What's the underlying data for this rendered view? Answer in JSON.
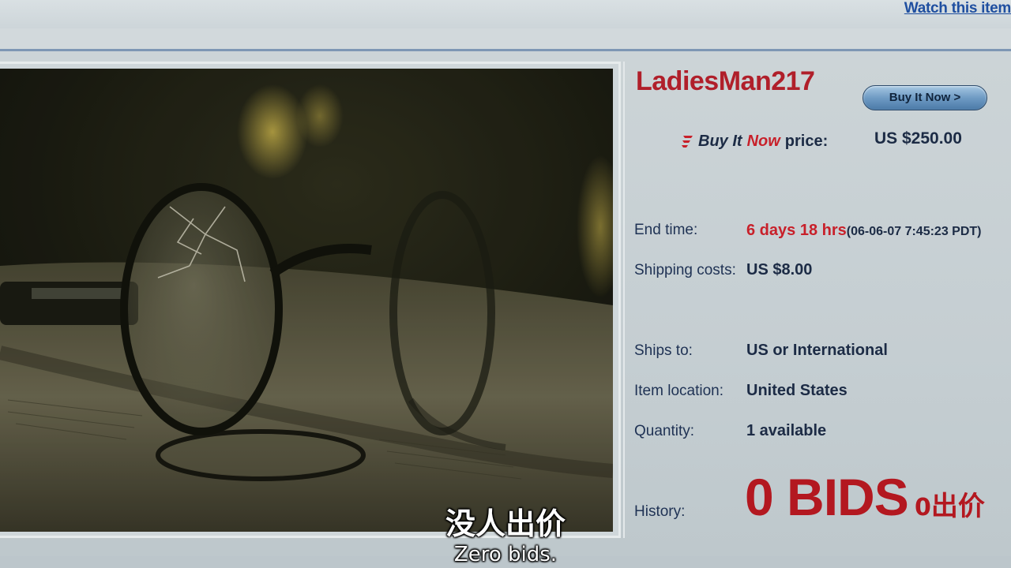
{
  "header": {
    "watch_link": "Watch this item"
  },
  "listing": {
    "seller": "LadiesMan217",
    "buy_button_label": "Buy It Now >",
    "bin_label_buy": "Buy It",
    "bin_label_now": "Now",
    "bin_label_price": "price:",
    "bin_price": "US $250.00",
    "fields": {
      "end_time_label": "End time:",
      "end_time_remaining": "6 days 18 hrs",
      "end_time_date": "(06-06-07 7:45:23 PDT)",
      "shipping_label": "Shipping costs:",
      "shipping_value": "US $8.00",
      "ships_to_label": "Ships to:",
      "ships_to_value": "US or International",
      "location_label": "Item location:",
      "location_value": "United States",
      "quantity_label": "Quantity:",
      "quantity_value": "1 available",
      "history_label": "History:",
      "history_value": "0 BIDS"
    }
  },
  "subtitles": {
    "chinese": "没人出价",
    "english": "Zero bids.",
    "overlay_zero": "0",
    "overlay_cn": "出价"
  },
  "colors": {
    "seller_red": "#b01f2a",
    "bids_red": "#b31820",
    "text_navy": "#1c2b45",
    "link_blue": "#1f4fa0"
  }
}
